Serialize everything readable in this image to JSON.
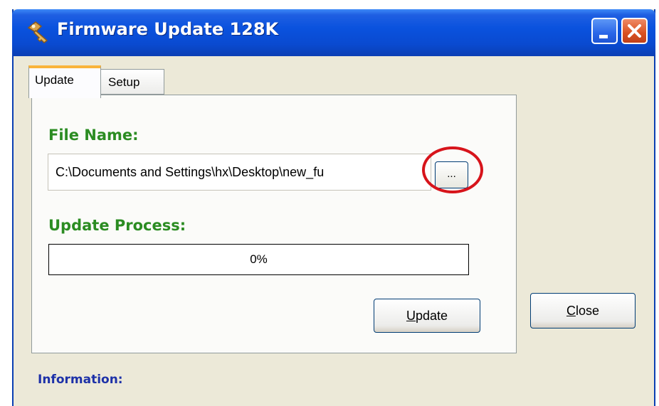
{
  "window": {
    "title": "Firmware Update 128K",
    "app_icon": "key-icon",
    "minimize_icon": "minimize-icon",
    "close_icon": "close-icon"
  },
  "tabs": [
    {
      "label": "Update",
      "active": true
    },
    {
      "label": "Setup",
      "active": false
    }
  ],
  "update_tab": {
    "file_name_label": "File Name:",
    "file_path": "C:\\Documents and Settings\\hx\\Desktop\\new_fu",
    "browse_label": "...",
    "update_process_label": "Update Process:",
    "progress_text": "0%",
    "progress_value": 0,
    "update_button": {
      "mnemonic": "U",
      "rest": "pdate"
    }
  },
  "close_button": {
    "mnemonic": "C",
    "rest": "lose"
  },
  "information_label": "Information:",
  "colors": {
    "titlebar": "#0a52de",
    "section_label": "#2b8c22",
    "info_label": "#1d31a8",
    "highlight": "#d7141b"
  }
}
